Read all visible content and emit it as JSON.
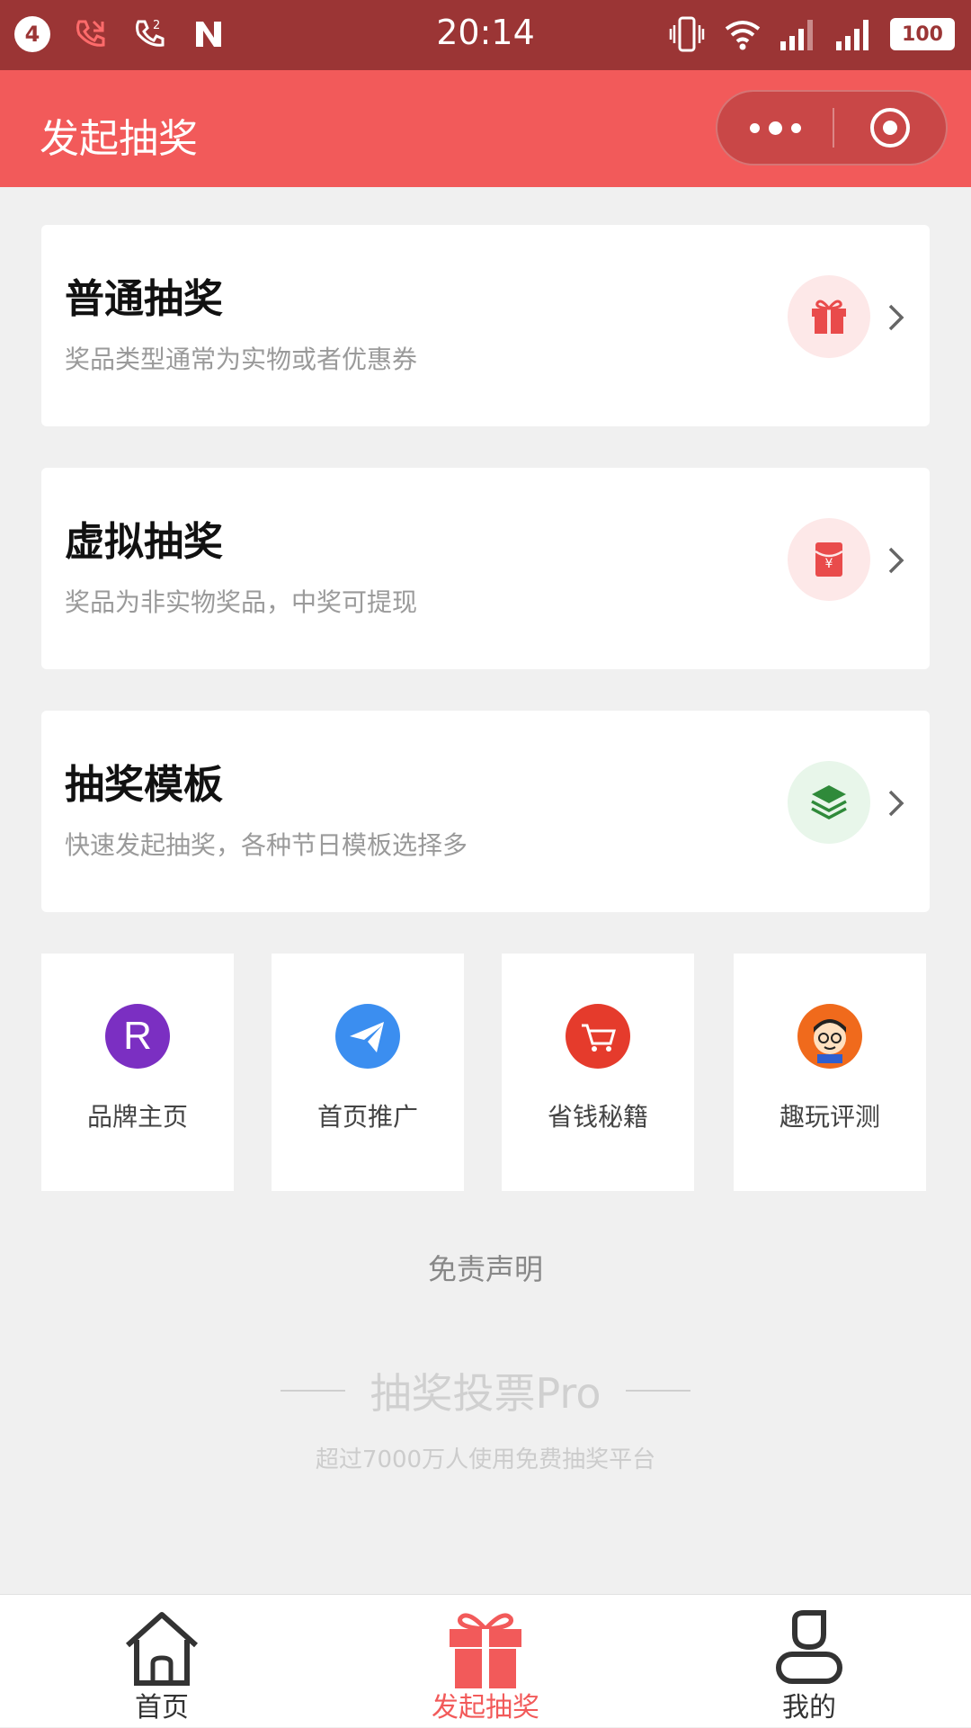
{
  "status_bar": {
    "notification_count": "4",
    "time": "20:14",
    "battery": "100",
    "icons": [
      "missed-call-icon",
      "call-forward-icon",
      "n-app-icon",
      "vibrate-icon",
      "wifi-icon",
      "signal-icon",
      "signal-icon"
    ]
  },
  "nav": {
    "title": "发起抽奖",
    "menu_icon": "more-dots-icon",
    "close_icon": "target-close-icon"
  },
  "cards": [
    {
      "title": "普通抽奖",
      "desc": "奖品类型通常为实物或者优惠券",
      "icon": "gift-icon",
      "icon_color": "#e94b4b",
      "icon_bg": "#fde8e8"
    },
    {
      "title": "虚拟抽奖",
      "desc": "奖品为非实物奖品，中奖可提现",
      "icon": "red-envelope-icon",
      "icon_color": "#e94b4b",
      "icon_bg": "#fde8e8"
    },
    {
      "title": "抽奖模板",
      "desc": "快速发起抽奖，各种节日模板选择多",
      "icon": "layers-icon",
      "icon_color": "#2f8a3a",
      "icon_bg": "#e8f6ea"
    }
  ],
  "tiles": [
    {
      "label": "品牌主页",
      "icon": "brand-r-icon",
      "color": "#7b2fc2"
    },
    {
      "label": "首页推广",
      "icon": "paper-plane-icon",
      "color": "#3b8ef0"
    },
    {
      "label": "省钱秘籍",
      "icon": "shopping-cart-icon",
      "color": "#e53b2c"
    },
    {
      "label": "趣玩评测",
      "icon": "cartoon-face-icon",
      "color": "#f06a1c"
    }
  ],
  "footer": {
    "disclaimer": "免责声明",
    "brand": "抽奖投票Pro",
    "subtitle": "超过7000万人使用免费抽奖平台"
  },
  "tab_bar": {
    "tabs": [
      {
        "label": "首页",
        "icon": "home-icon",
        "active": false
      },
      {
        "label": "发起抽奖",
        "icon": "gift-icon",
        "active": true
      },
      {
        "label": "我的",
        "icon": "user-icon",
        "active": false
      }
    ],
    "active_color": "#f25a5a"
  }
}
